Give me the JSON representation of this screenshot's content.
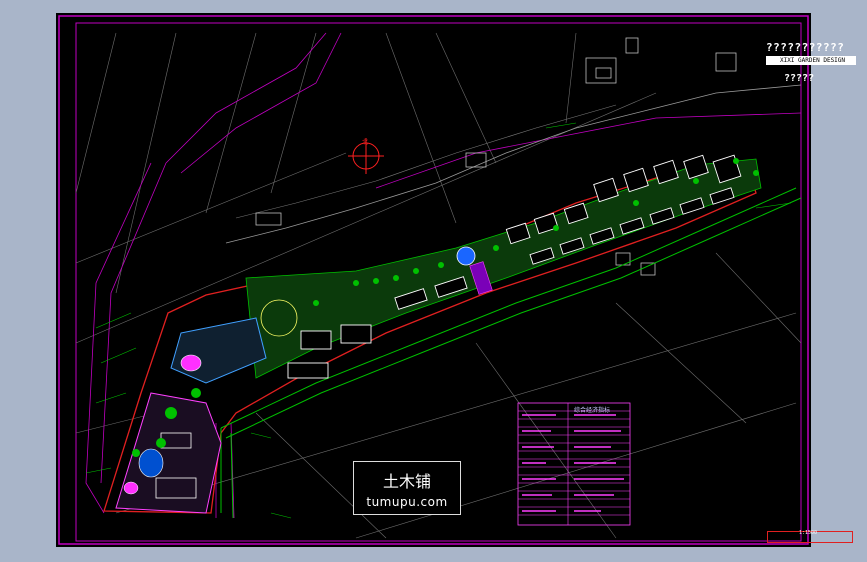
{
  "drawing": {
    "title_main": "???????????",
    "title_en": "XIXI GARDEN DESIGN",
    "title_sub": "?????",
    "legend_header": "综合经济指标",
    "scale_text": "1:1500"
  },
  "watermark": {
    "chinese": "土木铺",
    "url": "tumupu.com"
  },
  "colors": {
    "background": "#a9b5c9",
    "sheet": "#000000",
    "frame": "#c000c0",
    "grid": "#808080",
    "building": "#ffffff",
    "landscape": "#00c000",
    "boundary": "#e02020",
    "table": "#ff40ff",
    "compass": "#ff2020"
  }
}
